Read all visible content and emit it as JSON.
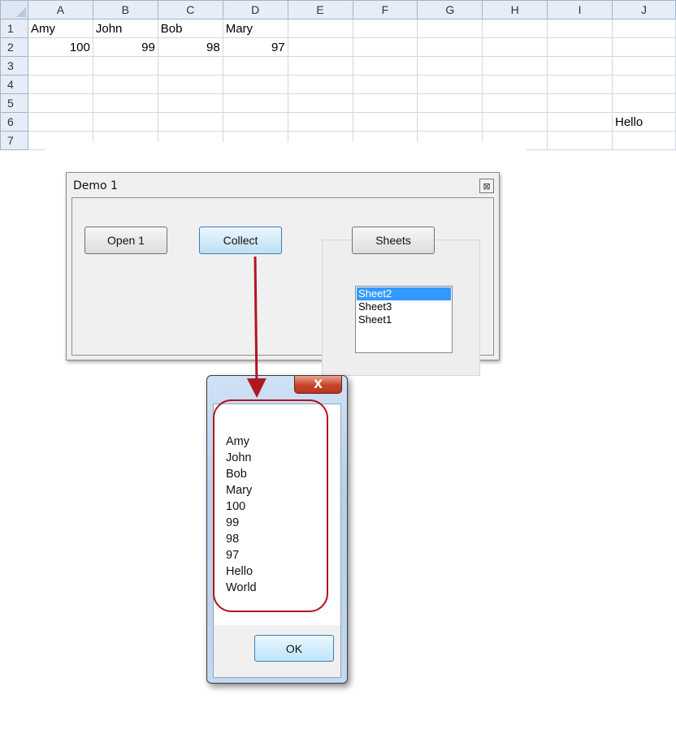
{
  "sheet": {
    "columns": [
      "A",
      "B",
      "C",
      "D",
      "E",
      "F",
      "G",
      "H",
      "I",
      "J"
    ],
    "rows": [
      {
        "num": "1",
        "cells": [
          "Amy",
          "John",
          "Bob",
          "Mary",
          "",
          "",
          "",
          "",
          "",
          ""
        ]
      },
      {
        "num": "2",
        "cells": [
          "100",
          "99",
          "98",
          "97",
          "",
          "",
          "",
          "",
          "",
          ""
        ]
      },
      {
        "num": "3",
        "cells": [
          "",
          "",
          "",
          "",
          "",
          "",
          "",
          "",
          "",
          ""
        ]
      },
      {
        "num": "4",
        "cells": [
          "",
          "",
          "",
          "",
          "",
          "",
          "",
          "",
          "",
          ""
        ]
      },
      {
        "num": "5",
        "cells": [
          "",
          "",
          "",
          "",
          "",
          "",
          "",
          "",
          "",
          ""
        ]
      },
      {
        "num": "6",
        "cells": [
          "",
          "",
          "",
          "",
          "",
          "",
          "",
          "",
          "",
          "Hello"
        ]
      },
      {
        "num": "7",
        "cells": [
          "",
          "",
          "",
          "",
          "",
          "",
          "",
          "",
          "",
          ""
        ]
      }
    ]
  },
  "userform": {
    "title": "Demo 1",
    "close_glyph": "⊠",
    "open_button": "Open 1",
    "collect_button": "Collect",
    "sheets_button": "Sheets",
    "sheet_list": [
      "Sheet2",
      "Sheet3",
      "Sheet1"
    ],
    "selected_sheet": "Sheet2"
  },
  "msgbox": {
    "close_glyph": "X",
    "lines": [
      "Amy",
      "John",
      "Bob",
      "Mary",
      "100",
      "99",
      "98",
      "97",
      "Hello",
      "World"
    ],
    "ok_button": "OK"
  },
  "colors": {
    "annotation": "#b0171f",
    "selection": "#3399ff",
    "grid_line": "#d0d7e5",
    "header_bg": "#e6edf7"
  }
}
